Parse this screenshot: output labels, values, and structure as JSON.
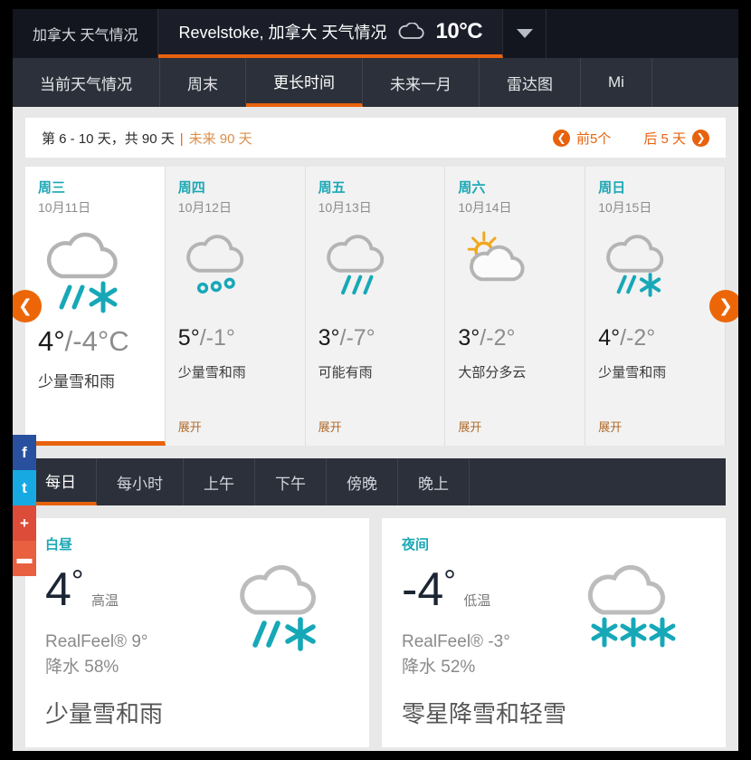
{
  "location_bar": {
    "tabs": [
      {
        "label": "加拿大 天气情况",
        "active": false
      },
      {
        "label": "Revelstoke, 加拿大 天气情况",
        "active": true
      }
    ],
    "current_temp": "10°C",
    "current_icon": "cloud-icon",
    "dropdown_icon": "chevron-down-icon"
  },
  "nav": {
    "tabs": [
      {
        "label": "当前天气情况",
        "active": false
      },
      {
        "label": "周末",
        "active": false
      },
      {
        "label": "更长时间",
        "active": true
      },
      {
        "label": "未来一月",
        "active": false
      },
      {
        "label": "雷达图",
        "active": false
      },
      {
        "label": "Mi",
        "active": false
      }
    ]
  },
  "infobar": {
    "range_text": "第 6 - 10 天，共 90 天",
    "separator": "|",
    "highlight_text": "未来 90 天",
    "prev_label": "前5个",
    "next_label": "后 5 天",
    "prev_icon": "arrow-left-circle-icon",
    "next_icon": "arrow-right-circle-icon"
  },
  "carousel": {
    "prev_icon": "chevron-left-icon",
    "next_icon": "chevron-right-icon",
    "expand_label": "展开",
    "days": [
      {
        "weekday": "周三",
        "date": "10月11日",
        "icon": "cloud-rain-snow-icon",
        "high": "4°",
        "separator": "/",
        "low": "-4°C",
        "phrase": "少量雪和雨",
        "active": true,
        "has_expand": false
      },
      {
        "weekday": "周四",
        "date": "10月12日",
        "icon": "cloud-sleet-icon",
        "high": "5°",
        "separator": "/",
        "low": "-1°",
        "phrase": "少量雪和雨",
        "active": false,
        "has_expand": true
      },
      {
        "weekday": "周五",
        "date": "10月13日",
        "icon": "cloud-rain-icon",
        "high": "3°",
        "separator": "/",
        "low": "-7°",
        "phrase": "可能有雨",
        "active": false,
        "has_expand": true
      },
      {
        "weekday": "周六",
        "date": "10月14日",
        "icon": "sun-cloud-icon",
        "high": "3°",
        "separator": "/",
        "low": "-2°",
        "phrase": "大部分多云",
        "active": false,
        "has_expand": true
      },
      {
        "weekday": "周日",
        "date": "10月15日",
        "icon": "cloud-rain-snow-icon",
        "high": "4°",
        "separator": "/",
        "low": "-2°",
        "phrase": "少量雪和雨",
        "active": false,
        "has_expand": true
      }
    ]
  },
  "subnav": {
    "tabs": [
      {
        "label": "每日",
        "active": true
      },
      {
        "label": "每小时",
        "active": false
      },
      {
        "label": "上午",
        "active": false
      },
      {
        "label": "下午",
        "active": false
      },
      {
        "label": "傍晚",
        "active": false
      },
      {
        "label": "晚上",
        "active": false
      }
    ]
  },
  "detail": {
    "day": {
      "title": "白昼",
      "temp": "4",
      "degree": "°",
      "temp_label": "高温",
      "realfeel": "RealFeel® 9°",
      "precip": "降水 58%",
      "phrase": "少量雪和雨",
      "icon": "cloud-rain-snow-icon"
    },
    "night": {
      "title": "夜间",
      "temp": "-4",
      "degree": "°",
      "temp_label": "低温",
      "realfeel": "RealFeel® -3°",
      "precip": "降水 52%",
      "phrase": "零星降雪和轻雪",
      "icon": "cloud-snow-icon"
    }
  },
  "social": {
    "items": [
      {
        "name": "facebook-share-button",
        "glyph": "f"
      },
      {
        "name": "twitter-share-button",
        "glyph": "t"
      },
      {
        "name": "googleplus-share-button",
        "glyph": "+"
      },
      {
        "name": "more-share-button",
        "glyph": "▬"
      }
    ]
  },
  "colors": {
    "accent": "#e8620d",
    "teal": "#1ba8b5",
    "header_bg": "#14161f",
    "nav_bg": "#2c303a"
  }
}
